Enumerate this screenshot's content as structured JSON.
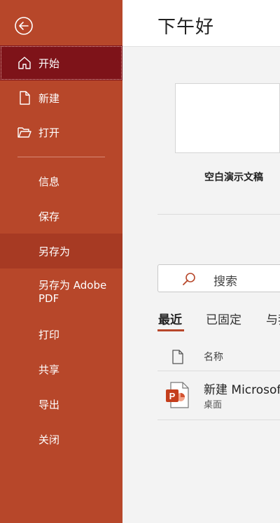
{
  "sidebar": {
    "items": [
      {
        "label": "开始"
      },
      {
        "label": "新建"
      },
      {
        "label": "打开"
      },
      {
        "label": "信息"
      },
      {
        "label": "保存"
      },
      {
        "label": "另存为"
      },
      {
        "label": "另存为 Adobe PDF"
      },
      {
        "label": "打印"
      },
      {
        "label": "共享"
      },
      {
        "label": "导出"
      },
      {
        "label": "关闭"
      }
    ]
  },
  "main": {
    "greeting": "下午好",
    "template_label": "空白演示文稿",
    "search_placeholder": "搜索",
    "tabs": [
      {
        "label": "最近"
      },
      {
        "label": "已固定"
      },
      {
        "label": "与我"
      }
    ],
    "column_header": "名称",
    "recent_files": [
      {
        "name": "新建 Microsoft",
        "location": "桌面"
      }
    ]
  },
  "colors": {
    "sidebar_bg": "#b7472a",
    "active_item_bg": "#7e1319",
    "selected_item_bg": "#a73a23",
    "accent": "#b7472a"
  },
  "icons": [
    "back-arrow-icon",
    "home-icon",
    "new-file-icon",
    "open-folder-icon",
    "search-icon",
    "file-icon",
    "powerpoint-icon"
  ]
}
